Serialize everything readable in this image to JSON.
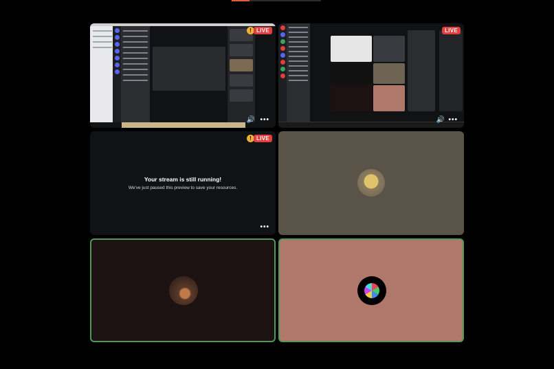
{
  "tiles": {
    "screen1": {
      "live_label": "LIVE",
      "warning_glyph": "!",
      "menu": "•••"
    },
    "screen2": {
      "live_label": "LIVE",
      "menu": "•••"
    },
    "paused": {
      "live_label": "LIVE",
      "warning_glyph": "!",
      "title": "Your stream is still running!",
      "subtitle": "We've just paused this preview to save your resources.",
      "menu": "•••"
    },
    "participant1": {
      "avatar": "duck-avatar"
    },
    "participant2": {
      "avatar": "dark-avatar",
      "speaking": true
    },
    "participant3": {
      "avatar": "colorful-cube-avatar",
      "speaking": true
    }
  },
  "colors": {
    "live": "#e23e3e",
    "warning": "#f0b232",
    "speaking_border": "#4f9a59",
    "tile4_bg": "#5a5347",
    "tile6_bg": "#b0776b"
  }
}
